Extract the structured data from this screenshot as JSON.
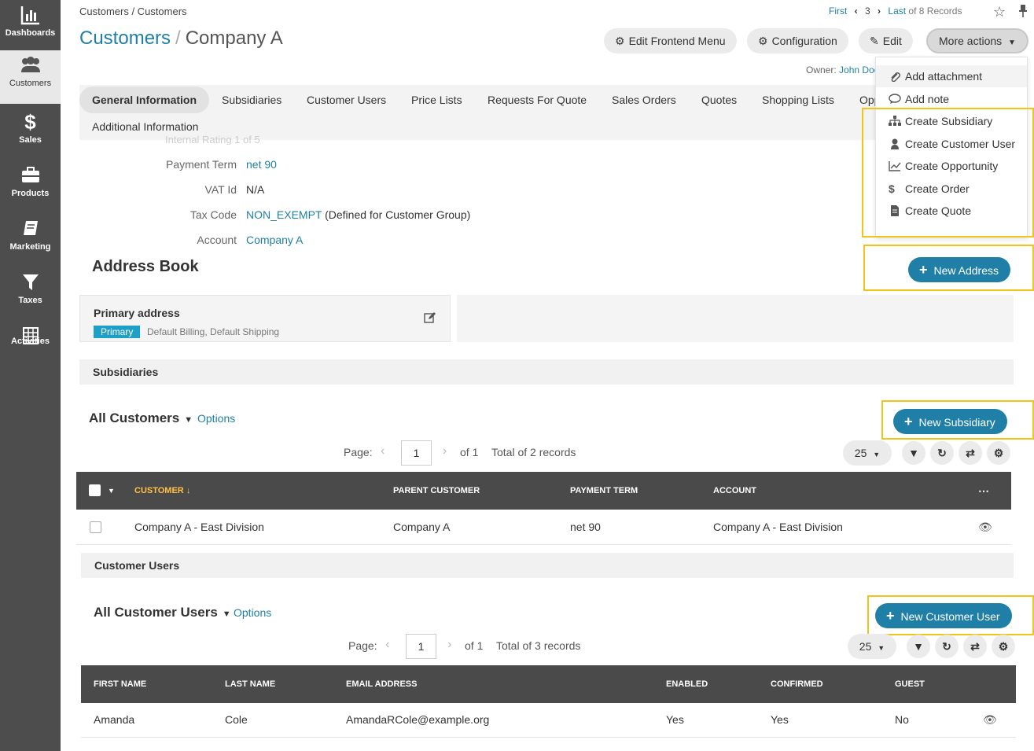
{
  "sidebar": {
    "items": [
      {
        "label": "Dashboards",
        "icon": "bar-chart-icon"
      },
      {
        "label": "Customers",
        "icon": "users-icon"
      },
      {
        "label": "Sales",
        "icon": "dollar-icon"
      },
      {
        "label": "Products",
        "icon": "briefcase-icon"
      },
      {
        "label": "Marketing",
        "icon": "book-icon"
      },
      {
        "label": "Taxes",
        "icon": "filter-icon"
      },
      {
        "label": "Activities",
        "icon": "calendar-icon"
      }
    ]
  },
  "breadcrumb": "Customers / Customers",
  "title": {
    "section": "Customers",
    "sep": "/",
    "entity": "Company A"
  },
  "record_nav": {
    "first": "First",
    "current": "3",
    "last": "Last",
    "count": "of 8 Records"
  },
  "actions": {
    "edit_frontend_menu": "Edit Frontend Menu",
    "configuration": "Configuration",
    "edit": "Edit",
    "more_actions": "More actions"
  },
  "owner": {
    "label": "Owner:",
    "name": "John Doe"
  },
  "tabs": [
    "General Information",
    "Subsidiaries",
    "Customer Users",
    "Price Lists",
    "Requests For Quote",
    "Sales Orders",
    "Quotes",
    "Shopping Lists",
    "Opportunities",
    "Additional Information"
  ],
  "info": {
    "faded_row": "Internal Rating    1 of 5",
    "rows": [
      {
        "label": "Payment Term",
        "value": "net 90",
        "note": ""
      },
      {
        "label": "VAT Id",
        "value": "N/A",
        "note": ""
      },
      {
        "label": "Tax Code",
        "value": "NON_EXEMPT",
        "note": "(Defined for Customer Group)"
      },
      {
        "label": "Account",
        "value": "Company A",
        "note": ""
      }
    ]
  },
  "address_book": {
    "title": "Address Book",
    "new_button": "New Address",
    "card_title": "Primary address",
    "badge": "Primary",
    "types": "Default Billing, Default Shipping"
  },
  "subsidiaries": {
    "section": "Subsidiaries",
    "grid_title": "All Customers",
    "options": "Options",
    "new_button": "New Subsidiary",
    "pager": {
      "label": "Page:",
      "page": "1",
      "of": "of 1",
      "total": "Total of 2 records",
      "size": "25"
    },
    "columns": [
      "CUSTOMER",
      "PARENT CUSTOMER",
      "PAYMENT TERM",
      "ACCOUNT"
    ],
    "rows": [
      {
        "customer": "Company A - East Division",
        "parent": "Company A",
        "payment_term": "net 90",
        "account": "Company A - East Division"
      }
    ]
  },
  "customer_users": {
    "section": "Customer Users",
    "grid_title": "All Customer Users",
    "options": "Options",
    "new_button": "New Customer User",
    "pager": {
      "label": "Page:",
      "page": "1",
      "of": "of 1",
      "total": "Total of 3 records",
      "size": "25"
    },
    "columns": [
      "FIRST NAME",
      "LAST NAME",
      "EMAIL ADDRESS",
      "ENABLED",
      "CONFIRMED",
      "GUEST"
    ],
    "rows": [
      {
        "first": "Amanda",
        "last": "Cole",
        "email": "AmandaRCole@example.org",
        "enabled": "Yes",
        "confirmed": "Yes",
        "guest": "No"
      }
    ]
  },
  "more_menu": [
    {
      "label": "Add attachment",
      "icon": "paperclip-icon"
    },
    {
      "label": "Add note",
      "icon": "comment-icon"
    },
    {
      "label": "Create Subsidiary",
      "icon": "sitemap-icon"
    },
    {
      "label": "Create Customer User",
      "icon": "user-icon"
    },
    {
      "label": "Create Opportunity",
      "icon": "line-chart-icon"
    },
    {
      "label": "Create Order",
      "icon": "dollar-icon"
    },
    {
      "label": "Create Quote",
      "icon": "document-icon"
    }
  ],
  "colors": {
    "sidebar": "#4d4d4d",
    "link": "#1f7fa6",
    "primary_button": "#1f7fa6",
    "table_header": "#4a4a4a",
    "sort_highlight": "#ffc145",
    "highlight_frame": "#f0c419"
  }
}
